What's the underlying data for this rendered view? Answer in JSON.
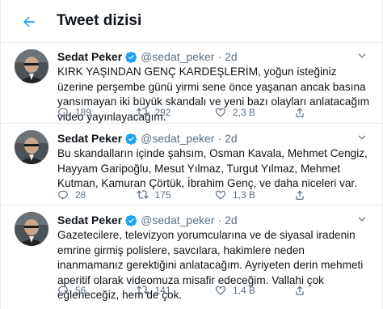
{
  "header": {
    "title": "Tweet dizisi",
    "back_icon": "arrow-left-icon"
  },
  "accent": "#1da1f2",
  "tweets": [
    {
      "name": "Sedat Peker",
      "handle": "@sedat_peker",
      "dot": "·",
      "time": "2d",
      "text": "KIRK YAŞINDAN GENÇ KARDEŞLERİM, yoğun isteğiniz üzerine perşembe günü yirmi sene önce yaşanan ancak basına yansımayan iki büyük skandalı ve yeni bazı olayları anlatacağım video yayınlayacağım.",
      "replies": "189",
      "retweets": "292",
      "likes": "2,3 B"
    },
    {
      "name": "Sedat Peker",
      "handle": "@sedat_peker",
      "dot": "·",
      "time": "2d",
      "text": "Bu skandalların içinde şahsım, Osman Kavala, Mehmet Cengiz, Hayyam Garipoğlu, Mesut Yılmaz, Turgut Yılmaz, Mehmet Kutman, Kamuran Çörtük, İbrahim Genç, ve daha niceleri var.",
      "replies": "28",
      "retweets": "175",
      "likes": "1,3 B"
    },
    {
      "name": "Sedat Peker",
      "handle": "@sedat_peker",
      "dot": "·",
      "time": "2d",
      "text": "Gazetecilere, televizyon yorumcularına ve de siyasal iradenin emrine girmiş polislere, savcılara, hakimlere neden inanmamanız gerektiğini anlatacağım. Ayriyeten derin mehmeti aperitif olarak videomuza misafir edeceğim. Vallahi çok eğleneceğiz, hem de çok.",
      "replies": "56",
      "retweets": "141",
      "likes": "1,4 B"
    }
  ]
}
